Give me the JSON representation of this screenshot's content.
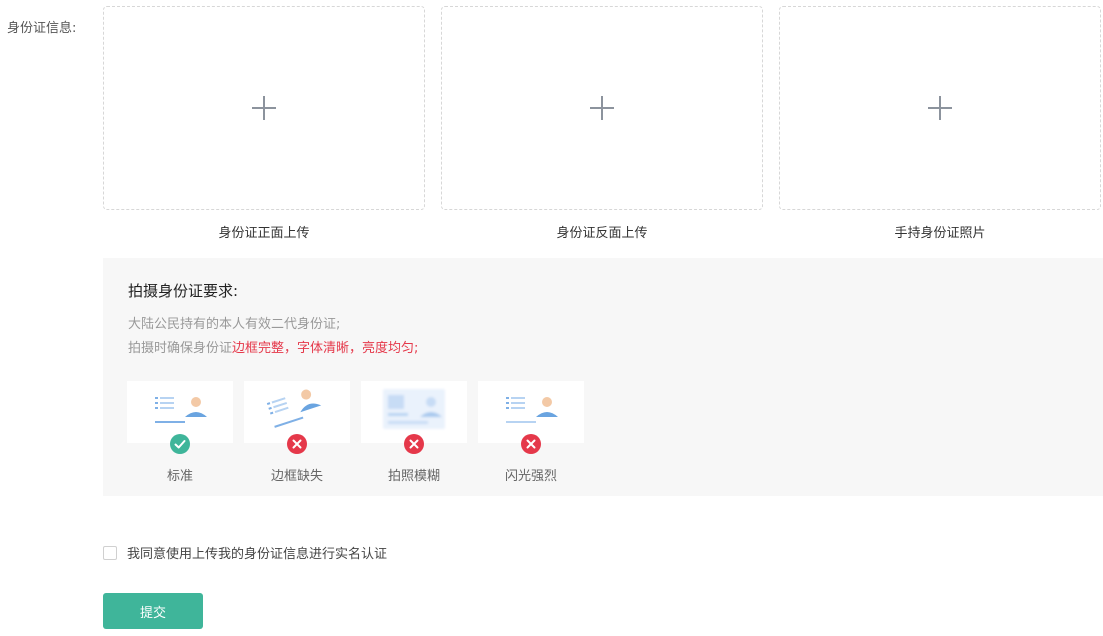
{
  "form": {
    "id_label": "身份证信息:"
  },
  "uploads": [
    {
      "caption": "身份证正面上传"
    },
    {
      "caption": "身份证反面上传"
    },
    {
      "caption": "手持身份证照片"
    }
  ],
  "requirements": {
    "title": "拍摄身份证要求:",
    "line1": "大陆公民持有的本人有效二代身份证;",
    "line2_prefix": "拍摄时确保身份证",
    "line2_highlight": "边框完整，字体清晰，亮度均匀;",
    "samples": [
      {
        "label": "标准",
        "status": "ok",
        "icon": "check-icon"
      },
      {
        "label": "边框缺失",
        "status": "bad",
        "icon": "cross-icon"
      },
      {
        "label": "拍照模糊",
        "status": "bad",
        "icon": "cross-icon"
      },
      {
        "label": "闪光强烈",
        "status": "bad",
        "icon": "cross-icon"
      }
    ]
  },
  "agreement": {
    "text": "我同意使用上传我的身份证信息进行实名认证",
    "checked": false
  },
  "submit_label": "提交",
  "colors": {
    "primary": "#3fb59a",
    "danger": "#e5384a",
    "panel_bg": "#f7f7f7"
  }
}
